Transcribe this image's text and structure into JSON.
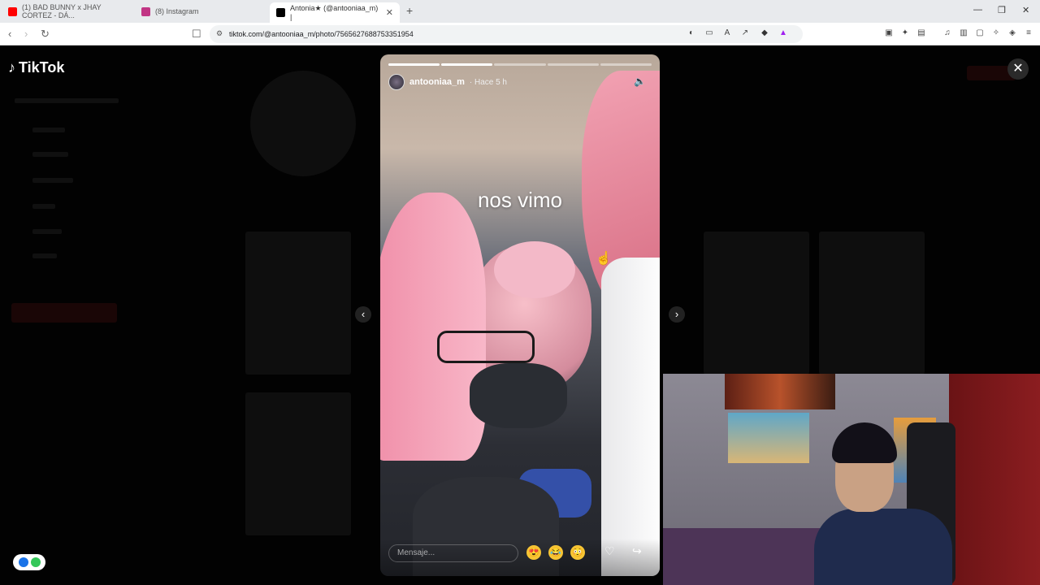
{
  "browser": {
    "tabs": [
      {
        "title": "(1) BAD BUNNY x JHAY CORTEZ - DÁ...",
        "favicon_color": "#ff0000",
        "active": false
      },
      {
        "title": "(8) Instagram",
        "favicon_color": "#c13584",
        "active": false
      },
      {
        "title": "Antonia★ (@antooniaa_m) |",
        "favicon_color": "#000000",
        "active": true
      }
    ],
    "new_tab": "+",
    "window_controls": {
      "minimize": "—",
      "restore": "❐",
      "close": "✕"
    },
    "url": "tiktok.com/@antooniaa_m/photo/7565627688753351954"
  },
  "tiktok": {
    "logo_text": "TikTok",
    "close_label": "✕",
    "prev_label": "‹",
    "next_label": "›"
  },
  "story": {
    "username": "antooniaa_m",
    "time": "· Hace 5 h",
    "caption": "nos vimo",
    "progress_total": 5,
    "progress_done": 2,
    "message_placeholder": "Mensaje...",
    "reactions": [
      "😍",
      "😂",
      "😳"
    ]
  },
  "colors": {
    "tiktok_bg": "#020202",
    "story_text": "#ffffff"
  }
}
